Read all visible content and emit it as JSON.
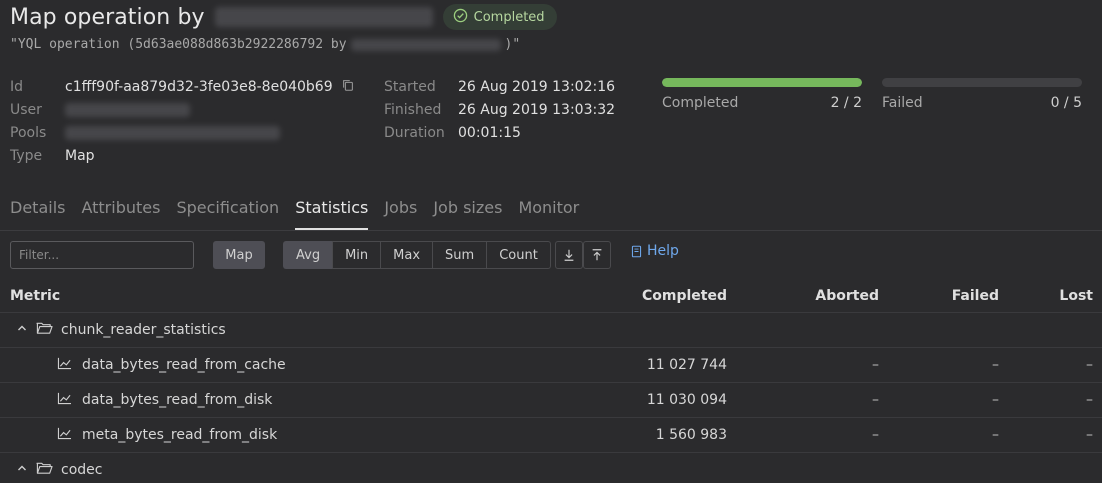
{
  "header": {
    "title": "Map operation by",
    "status": "Completed",
    "subtitle_prefix": "\"YQL operation (5d63ae088d863b2922286792 by",
    "subtitle_suffix": ")\""
  },
  "meta_left": [
    {
      "label": "Id",
      "value": "c1fff90f-aa879d32-3fe03e8-8e040b69"
    },
    {
      "label": "User",
      "value": ""
    },
    {
      "label": "Pools",
      "value": ""
    },
    {
      "label": "Type",
      "value": "Map"
    }
  ],
  "meta_mid": [
    {
      "label": "Started",
      "value": "26 Aug 2019 13:02:16"
    },
    {
      "label": "Finished",
      "value": "26 Aug 2019 13:03:32"
    },
    {
      "label": "Duration",
      "value": "00:01:15"
    }
  ],
  "progress": {
    "completed": {
      "label": "Completed",
      "count": "2 / 2",
      "fraction": 1.0
    },
    "failed": {
      "label": "Failed",
      "count": "0 / 5",
      "fraction": 0.0
    }
  },
  "tabs": [
    "Details",
    "Attributes",
    "Specification",
    "Statistics",
    "Jobs",
    "Job sizes",
    "Monitor"
  ],
  "active_tab": "Statistics",
  "toolbar": {
    "filter_placeholder": "Filter...",
    "map_label": "Map",
    "aggregations": [
      "Avg",
      "Min",
      "Max",
      "Sum",
      "Count"
    ],
    "active_aggregation": "Avg",
    "help_label": "Help"
  },
  "table": {
    "columns": {
      "metric": "Metric",
      "completed": "Completed",
      "aborted": "Aborted",
      "failed": "Failed",
      "lost": "Lost"
    },
    "groups": [
      {
        "name": "chunk_reader_statistics"
      },
      {
        "name": "codec"
      }
    ],
    "rows": [
      {
        "name": "data_bytes_read_from_cache",
        "completed": "11 027 744",
        "aborted": "–",
        "failed": "–",
        "lost": "–"
      },
      {
        "name": "data_bytes_read_from_disk",
        "completed": "11 030 094",
        "aborted": "–",
        "failed": "–",
        "lost": "–"
      },
      {
        "name": "meta_bytes_read_from_disk",
        "completed": "1 560 983",
        "aborted": "–",
        "failed": "–",
        "lost": "–"
      }
    ]
  },
  "colors": {
    "accent_green": "#76b85c",
    "link_blue": "#6fa8ec",
    "background": "#2b2b2d"
  }
}
